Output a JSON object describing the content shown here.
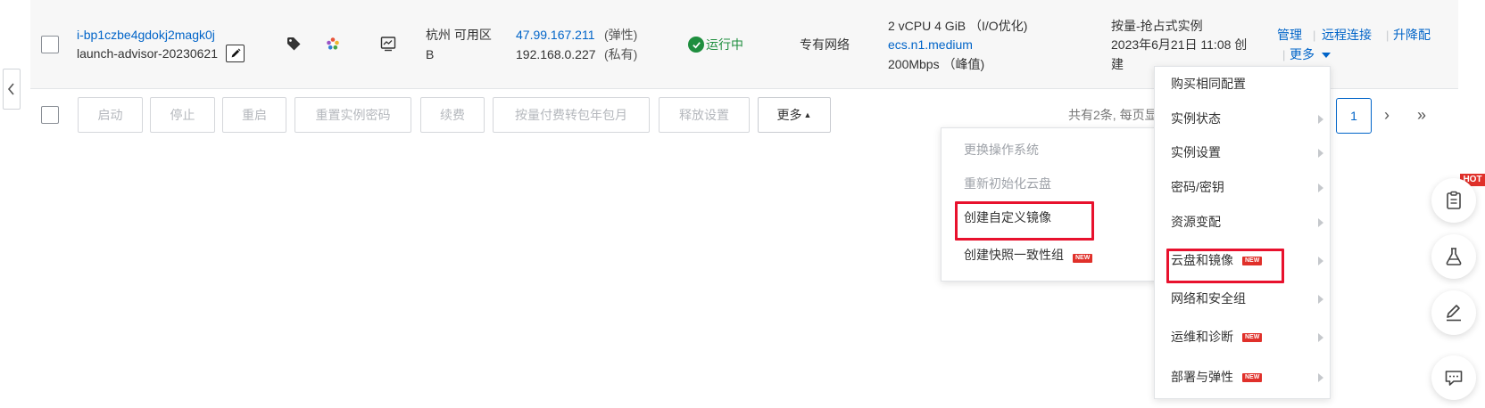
{
  "instance": {
    "id": "i-bp1czbe4gdokj2magk0j",
    "name": "launch-advisor-20230621",
    "zone_line1": "杭州 可用区",
    "zone_line2": "B",
    "public_ip": "47.99.167.211",
    "public_ip_type": "(弹性)",
    "private_ip": "192.168.0.227",
    "private_ip_type": "(私有)",
    "status": "运行中",
    "network": "专有网络",
    "spec_line1": "2 vCPU 4 GiB （I/O优化)",
    "spec_type": "ecs.n1.medium",
    "bandwidth": "200Mbps （峰值)",
    "billing_line1": "按量-抢占式实例",
    "billing_line2": "2023年6月21日 11:08 创",
    "billing_line3": "建",
    "icons": [
      "tag-icon",
      "flower-icon",
      "monitor-icon",
      "edit-icon"
    ]
  },
  "actions": {
    "manage": "管理",
    "remote": "远程连接",
    "upgrade": "升降配",
    "more": "更多",
    "separator": "|"
  },
  "bulk_buttons": {
    "start": "启动",
    "stop": "停止",
    "restart": "重启",
    "reset_password": "重置实例密码",
    "renew": "续费",
    "convert": "按量付费转包年包月",
    "release": "释放设置",
    "more": "更多"
  },
  "pagination": {
    "summary": "共有2条, 每页显",
    "current_page": "1",
    "next": "›",
    "last": "»"
  },
  "submenu": {
    "items": [
      {
        "label": "更换操作系统",
        "enabled": false
      },
      {
        "label": "重新初始化云盘",
        "enabled": false
      },
      {
        "label": "创建自定义镜像",
        "enabled": true
      },
      {
        "label": "创建快照一致性组",
        "enabled": true,
        "badge": "NEW"
      }
    ]
  },
  "more_menu": {
    "items": [
      {
        "label": "购买相同配置"
      },
      {
        "label": "实例状态"
      },
      {
        "label": "实例设置"
      },
      {
        "label": "密码/密钥"
      },
      {
        "label": "资源变配"
      },
      {
        "label": "云盘和镜像",
        "badge": "NEW"
      },
      {
        "label": "网络和安全组"
      },
      {
        "label": "运维和诊断",
        "badge": "NEW"
      },
      {
        "label": "部署与弹性",
        "badge": "NEW"
      }
    ]
  },
  "floating": {
    "hot_badge": "HOT",
    "icons": [
      "clipboard-icon",
      "flask-icon",
      "pen-icon",
      "chat-icon"
    ]
  },
  "colors": {
    "link": "#0064c8",
    "running": "#1e8e3e",
    "highlight": "#e8112d",
    "badge": "#e0302a"
  }
}
